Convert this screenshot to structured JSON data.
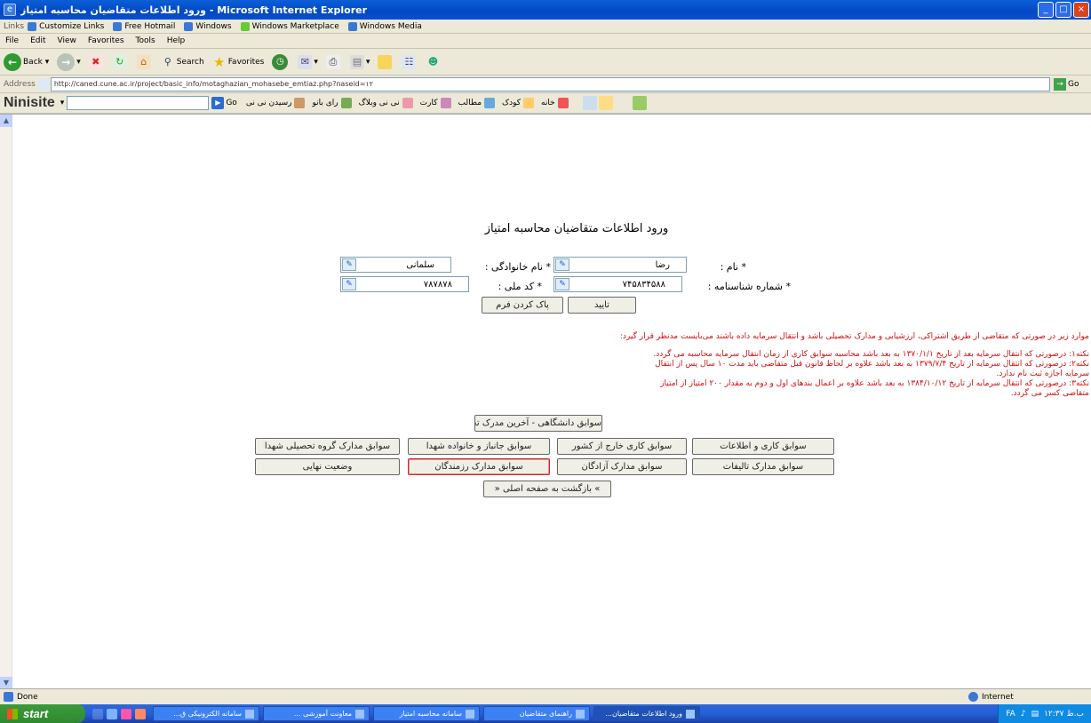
{
  "window": {
    "title": "ورود اطلاعات متقاضیان محاسبه امتیاز - Microsoft Internet Explorer",
    "controls": [
      "_",
      "□",
      "×"
    ]
  },
  "links_bar": {
    "label": "Links",
    "items": [
      "Customize Links",
      "Free Hotmail",
      "Windows",
      "Windows Marketplace",
      "Windows Media"
    ]
  },
  "menu": [
    "File",
    "Edit",
    "View",
    "Favorites",
    "Tools",
    "Help"
  ],
  "toolbar": {
    "back": "Back",
    "search": "Search",
    "favorites": "Favorites"
  },
  "address": {
    "label": "Address",
    "url": "http://caned.cune.ac.ir/project/basic_info/motaghazian_mohasebe_emtiaz.php?naseid=۱۲",
    "go": "Go"
  },
  "ninisite": {
    "brand": "Ninisite",
    "go": "Go",
    "items": [
      "رسیدن نی نی",
      "رای بانو",
      "نی نی وبلاگ",
      "کارت",
      "مطالب",
      "کودک",
      "خانه"
    ]
  },
  "page": {
    "title": "ورود اطلاعات متقاضیان محاسبه امتیاز",
    "form": {
      "first_name_label": "* نام :",
      "first_name_value": "رضا",
      "last_name_label": "* نام خانوادگی :",
      "last_name_value": "سلمانی",
      "id_number_label": "* شماره شناسنامه :",
      "id_number_value": "۷۴۵۸۳۴۵۸۸",
      "national_code_label": "* کد ملی :",
      "national_code_value": "۷۸۷۸۷۸",
      "submit": "تایید",
      "clear": "پاک کردن فرم"
    },
    "notes": [
      "موارد زیر در صورتی که متقاضی از طریق اشتراکی، ارزشیابی و مدارک تحصیلی باشد و انتقال سرمایه داده باشند می‌بایست مدنظر قرار گیرد:",
      "نکته۱: درصورتی که انتقال سرمایه بعد از تاریخ ۱۳۷۰/۱/۱ به بعد باشد محاسبه سوابق کاری از زمان انتقال سرمایه محاسبه می گردد.",
      "نکته۲: درصورتی که انتقال سرمایه از تاریخ ۱۳۷۹/۷/۴ به بعد باشد علاوه بر لحاظ قانون قبل متقاضی باید مدت ۱۰ سال پس از انتقال",
      "سرمایه اجازه ثبت نام ندارد.",
      "نکته۳: درصورتی که انتقال سرمایه از تاریخ ۱۳۸۴/۱۰/۱۲ به بعد باشد علاوه بر اعمال بندهای اول و دوم به مقدار ۲۰۰ امتیاز از امتیاز",
      "متقاضی کسر می گردد."
    ],
    "buttons": {
      "last_degree": "سوابق دانشگاهی - آخرین مدرک تحصیلی",
      "row1": [
        "سوابق کاری و اطلاعات",
        "سوابق کاری خارج از کشور",
        "سوابق جانباز و خانواده شهدا",
        "سوابق مدارک گروه تحصیلی شهدا"
      ],
      "row2": [
        "سوابق مدارک تالیفات",
        "سوابق مدارک آزادگان",
        "سوابق مدارک رزمندگان",
        "وضعیت نهایی"
      ],
      "final": "» بازگشت به صفحه اصلی «"
    }
  },
  "status": {
    "left": "Done",
    "zone": "Internet"
  },
  "taskbar": {
    "start": "start",
    "tasks": [
      "سامانه الکترونیکی ق...",
      "معاونت آموزشی ...",
      "سامانه محاسبه امتیاز",
      "راهنمای متقاضیان",
      "ورود اطلاعات متقاضیان..."
    ],
    "tray_lang": "FA",
    "clock": "۱۲:۳۷ ب.ظ"
  },
  "colors": {
    "note_text": "#d01010",
    "title_bar": "#0a5fd8",
    "taskbar": "#245edb",
    "start": "#3c9a3c"
  }
}
